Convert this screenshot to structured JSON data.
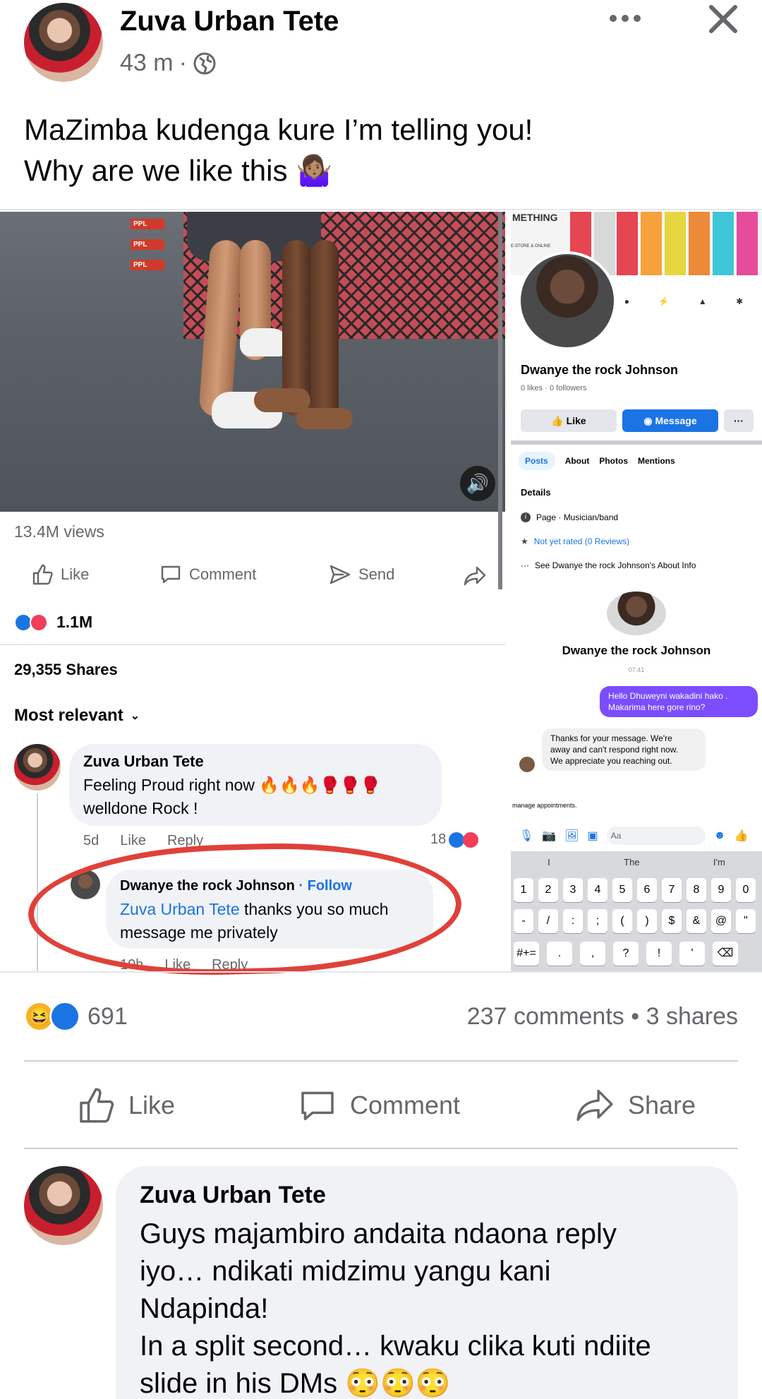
{
  "post": {
    "author": "Zuva Urban Tete",
    "time": "43 m",
    "time_sep": "·",
    "text_line1": "MaZimba kudenga kure I’m telling you!",
    "text_line2": "Why are we like this 🤷🏽‍♀️",
    "more_icon": "more-icon",
    "close_icon": "close-icon"
  },
  "embedded": {
    "views": "13.4M views",
    "like": "Like",
    "comment": "Comment",
    "send": "Send",
    "reactions_count": "1.1M",
    "shares": "29,355 Shares",
    "sort": "Most relevant",
    "comment1": {
      "author": "Zuva Urban Tete",
      "text_line1": "Feeling Proud right now 🔥🔥🔥🥊🥊🥊",
      "text_line2": "welldone Rock !",
      "time": "5d",
      "like": "Like",
      "reply": "Reply",
      "react_count": "18"
    },
    "reply1": {
      "author": "Dwanye the rock Johnson",
      "follow": "· Follow",
      "mention": "Zuva Urban Tete",
      "text_rest": " thanks you so much",
      "text_line2": "message me privately",
      "time": "10h",
      "like": "Like",
      "reply": "Reply"
    }
  },
  "right_panel": {
    "top_text": "METHING",
    "store_text": "E-STORE & ONLINE",
    "page_name": "Dwanye the rock Johnson",
    "likes": "0 likes",
    "followers": "0 followers",
    "like_btn": "Like",
    "message_btn": "Message",
    "more_btn": "···",
    "tabs": [
      "Posts",
      "About",
      "Photos",
      "Mentions"
    ],
    "details_title": "Details",
    "detail_page": "Page · Musician/band",
    "detail_rating": "Not yet rated (0 Reviews)",
    "detail_about": "See Dwanye the rock Johnson's About Info",
    "chat_name": "Dwanye the rock Johnson",
    "chat_time": "07:41",
    "msg_out_line1": "Hello Dhuweyni wakadini hako .",
    "msg_out_line2": "Makarima here gore rino?",
    "msg_in_line1": "Thanks for your message. We're",
    "msg_in_line2": "away and can't respond right now.",
    "msg_in_line3": "We appreciate you reaching out.",
    "manage_text": "manage appointments.",
    "input_placeholder": "Aa",
    "suggestions": [
      "I",
      "The",
      "I'm"
    ],
    "keys_row1": [
      "1",
      "2",
      "3",
      "4",
      "5",
      "6",
      "7",
      "8",
      "9",
      "0"
    ],
    "keys_row2": [
      "-",
      "/",
      ":",
      ";",
      "(",
      ")",
      "$",
      "&",
      "@",
      "\""
    ],
    "keys_row3": [
      "#+=",
      ".",
      ",",
      "?",
      "!",
      "'",
      "⌫"
    ]
  },
  "summary": {
    "reactions_count": "691",
    "comments_shares": "237 comments • 3 shares"
  },
  "actions": {
    "like": "Like",
    "comment": "Comment",
    "share": "Share"
  },
  "bottom_comment": {
    "author": "Zuva Urban Tete",
    "line1": "Guys majambiro andaita ndaona reply",
    "line2": "iyo… ndikati midzimu yangu kani",
    "line3": "Ndapinda!",
    "line4": "In a split second… kwaku clika kuti ndiite",
    "line5": "slide in his DMs 😳😳😳"
  },
  "colors": {
    "brand_blue": "#1b74e4",
    "messenger_purple": "#7b4dff",
    "red_circle": "#e0413a",
    "gray_text": "#65676b"
  }
}
